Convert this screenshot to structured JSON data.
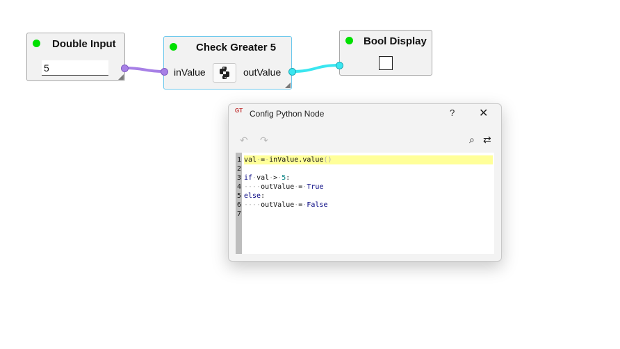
{
  "nodes": {
    "double_input": {
      "title": "Double Input",
      "value": "5"
    },
    "check_greater": {
      "title": "Check Greater 5",
      "in_port": "inValue",
      "out_port": "outValue"
    },
    "bool_display": {
      "title": "Bool Display",
      "checked": false
    }
  },
  "dialog": {
    "title": "Config Python Node",
    "help": "?",
    "close": "✕",
    "icon_text": "GT",
    "toolbar": {
      "undo": "↶",
      "redo": "↷",
      "search": "⌕",
      "replace": "⇄"
    },
    "line_numbers": [
      "1",
      "2",
      "3",
      "4",
      "5",
      "6",
      "7"
    ],
    "code": [
      [
        [
          "ident",
          "val"
        ],
        [
          "ws",
          "·"
        ],
        [
          "op",
          "="
        ],
        [
          "ws",
          "·"
        ],
        [
          "ident",
          "inValue.value"
        ],
        [
          "ws",
          "()"
        ]
      ],
      [],
      [
        [
          "kw",
          "if"
        ],
        [
          "ws",
          "·"
        ],
        [
          "ident",
          "val"
        ],
        [
          "ws",
          "·"
        ],
        [
          "op",
          ">"
        ],
        [
          "ws",
          "·"
        ],
        [
          "num",
          "5"
        ],
        [
          "op",
          ":"
        ]
      ],
      [
        [
          "ws",
          "····"
        ],
        [
          "ident",
          "outValue"
        ],
        [
          "ws",
          "·"
        ],
        [
          "op",
          "="
        ],
        [
          "ws",
          "·"
        ],
        [
          "kw",
          "True"
        ]
      ],
      [
        [
          "kw",
          "else"
        ],
        [
          "op",
          ":"
        ]
      ],
      [
        [
          "ws",
          "····"
        ],
        [
          "ident",
          "outValue"
        ],
        [
          "ws",
          "·"
        ],
        [
          "op",
          "="
        ],
        [
          "ws",
          "·"
        ],
        [
          "kw",
          "False"
        ]
      ],
      []
    ]
  },
  "colors": {
    "status_green": "#00e000",
    "purple_connection": "#a780e6",
    "cyan_connection": "#3ae6f0",
    "selected_border": "#6cc8ec",
    "current_line": "#ffff99"
  }
}
